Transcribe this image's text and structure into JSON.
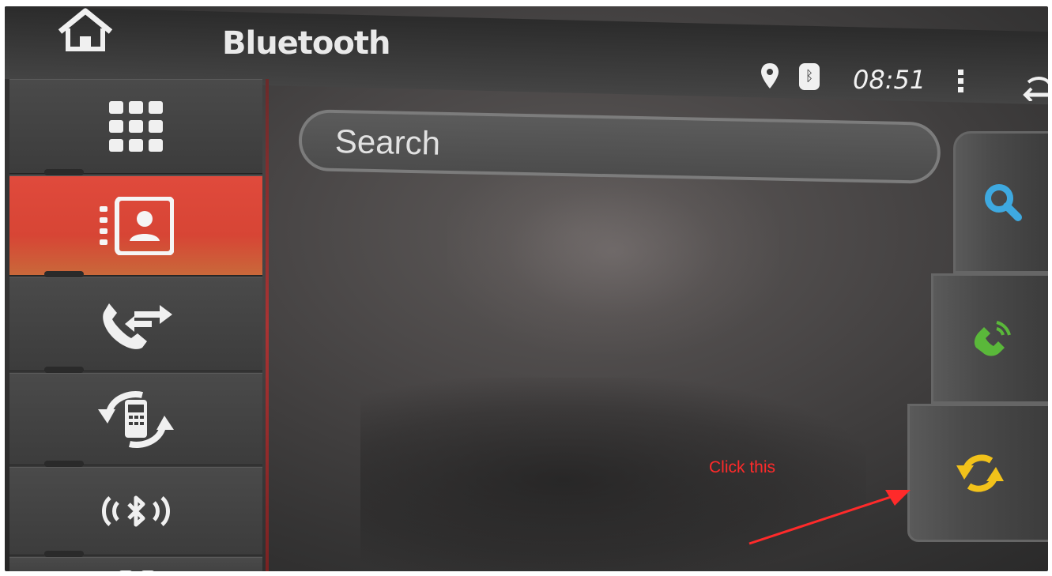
{
  "header": {
    "title": "Bluetooth",
    "time": "08:51",
    "icons": [
      "home-icon",
      "location-icon",
      "bluetooth-icon",
      "more-menu-icon",
      "back-icon"
    ]
  },
  "search": {
    "placeholder": "Search",
    "value": ""
  },
  "sidebar": {
    "items": [
      {
        "icon": "apps-grid-icon",
        "active": false
      },
      {
        "icon": "contacts-icon",
        "active": true
      },
      {
        "icon": "call-log-icon",
        "active": false
      },
      {
        "icon": "phonebook-sync-icon",
        "active": false
      },
      {
        "icon": "bluetooth-connect-icon",
        "active": false
      },
      {
        "icon": "more-icon",
        "active": false
      }
    ]
  },
  "right_panel": {
    "buttons": [
      {
        "icon": "search-icon",
        "color": "#3ea9e0"
      },
      {
        "icon": "call-icon",
        "color": "#5ab83a"
      },
      {
        "icon": "sync-icon",
        "color": "#f2c21a"
      }
    ]
  },
  "annotation": {
    "text": "Click this",
    "color": "#ff2a2a"
  },
  "colors": {
    "active_tab": "#d94636",
    "background": "#444444"
  }
}
